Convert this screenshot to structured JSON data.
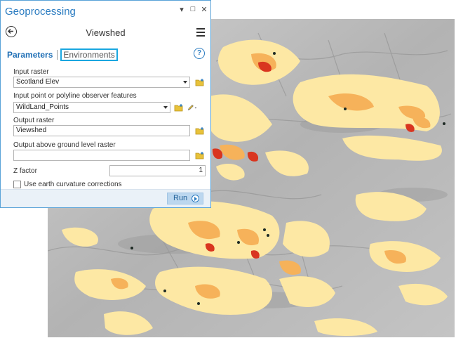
{
  "pane": {
    "title": "Geoprocessing",
    "window_buttons": [
      "▾",
      "□",
      "✕"
    ]
  },
  "tool": {
    "name": "Viewshed",
    "back_icon": "back-arrow-icon",
    "menu_icon": "hamburger-menu-icon"
  },
  "tabs": {
    "parameters": "Parameters",
    "environments": "Environments",
    "help_glyph": "?"
  },
  "params": {
    "input_raster_label": "Input raster",
    "input_raster_value": "Scotland Elev",
    "observer_label": "Input point or polyline observer features",
    "observer_value": "WildLand_Points",
    "output_raster_label": "Output raster",
    "output_raster_value": "Viewshed",
    "agl_label": "Output above ground level raster",
    "agl_value": "",
    "zfactor_label": "Z factor",
    "zfactor_value": "1",
    "curvature_label": "Use earth curvature corrections",
    "curvature_checked": false
  },
  "run": {
    "label": "Run"
  },
  "colors": {
    "accent": "#2b7cc1",
    "env_highlight": "#1aa7e0",
    "folder_yellow": "#e8c23a",
    "viewshed_light": "#fde8a4",
    "viewshed_mid": "#f6b25a",
    "viewshed_high": "#d9351f",
    "hillshade": "#b9b9b9"
  }
}
